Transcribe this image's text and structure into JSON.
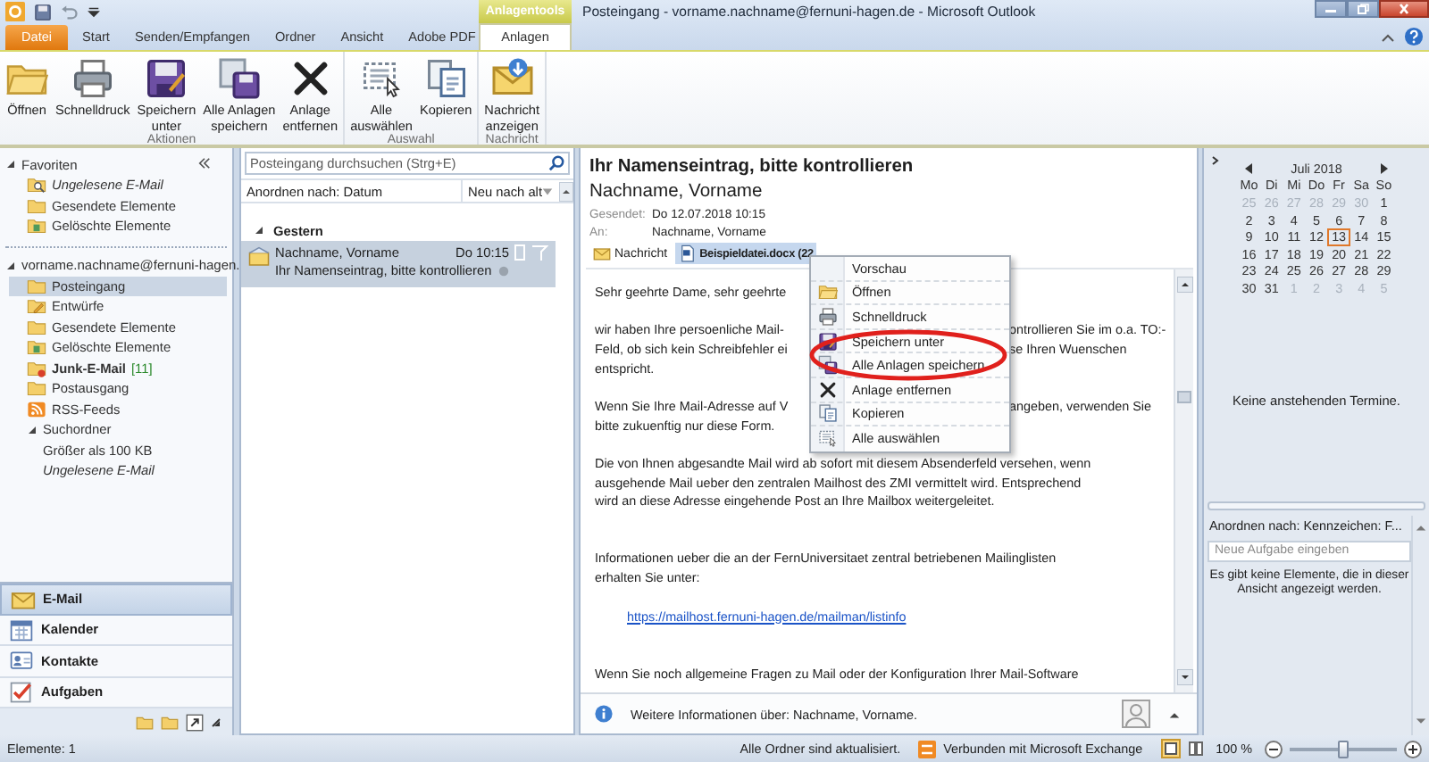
{
  "window": {
    "title": "Posteingang - vorname.nachname@fernuni-hagen.de - Microsoft Outlook",
    "contextual_group": "Anlagentools"
  },
  "ribbon": {
    "tabs": [
      {
        "label": "Datei",
        "kind": "file",
        "selected": false
      },
      {
        "label": "Start",
        "kind": "tab",
        "selected": false
      },
      {
        "label": "Senden/Empfangen",
        "kind": "tab",
        "selected": false
      },
      {
        "label": "Ordner",
        "kind": "tab",
        "selected": false
      },
      {
        "label": "Ansicht",
        "kind": "tab",
        "selected": false
      },
      {
        "label": "Adobe PDF",
        "kind": "tab",
        "selected": false
      },
      {
        "label": "Anlagen",
        "kind": "contextual",
        "selected": true
      }
    ],
    "groups": [
      {
        "label": "Aktionen",
        "buttons": [
          {
            "kind": "openfolder",
            "label": [
              "Öffnen"
            ]
          },
          {
            "kind": "printer",
            "label": [
              "Schnelldruck"
            ]
          },
          {
            "kind": "floppy",
            "label": [
              "Speichern",
              "unter"
            ]
          },
          {
            "kind": "floppies",
            "label": [
              "Alle Anlagen",
              "speichern"
            ]
          },
          {
            "kind": "cross",
            "label": [
              "Anlage",
              "entfernen"
            ]
          }
        ]
      },
      {
        "label": "Auswahl",
        "buttons": [
          {
            "kind": "selection",
            "label": [
              "Alle",
              "auswählen"
            ]
          },
          {
            "kind": "copy",
            "label": [
              "Kopieren"
            ]
          }
        ]
      },
      {
        "label": "Nachricht",
        "buttons": [
          {
            "kind": "envarrow",
            "label": [
              "Nachricht",
              "anzeigen"
            ]
          }
        ]
      }
    ]
  },
  "navigation": {
    "sections": [
      {
        "label": "Favoriten",
        "expanded": true,
        "items": [
          {
            "label": "Ungelesene E-Mail",
            "kind": "search",
            "selected": false,
            "unread": false,
            "empty": true
          },
          {
            "label": "Gesendete Elemente",
            "kind": "folder",
            "selected": false,
            "unread": false,
            "empty": false
          },
          {
            "label": "Gelöschte Elemente",
            "kind": "trash",
            "selected": false,
            "unread": false,
            "empty": false
          }
        ]
      },
      {
        "label": "vorname.nachname@fernuni-hagen.",
        "expanded": true,
        "items": [
          {
            "label": "Posteingang",
            "kind": "folder",
            "selected": true,
            "unread": false,
            "empty": false
          },
          {
            "label": "Entwürfe",
            "kind": "drafts",
            "selected": false,
            "unread": false,
            "empty": false
          },
          {
            "label": "Gesendete Elemente",
            "kind": "folder",
            "selected": false,
            "unread": false,
            "empty": false
          },
          {
            "label": "Gelöschte Elemente",
            "kind": "trash",
            "selected": false,
            "unread": false,
            "empty": false
          },
          {
            "label": "Junk-E-Mail",
            "count": "[11]",
            "kind": "junk",
            "selected": false,
            "unread": true,
            "empty": false
          },
          {
            "label": "Postausgang",
            "kind": "folder",
            "selected": false,
            "unread": false,
            "empty": false
          },
          {
            "label": "RSS-Feeds",
            "kind": "rss",
            "selected": false,
            "unread": false,
            "empty": false
          },
          {
            "label": "Suchordner",
            "selected": false,
            "unread": false,
            "empty": false,
            "expanded": true,
            "children": [
              {
                "label": "Größer als 100 KB",
                "selected": false,
                "unread": false,
                "empty": false
              },
              {
                "label": "Ungelesene E-Mail",
                "selected": false,
                "unread": false,
                "empty": true
              }
            ]
          }
        ]
      }
    ],
    "modules": [
      {
        "label": "E-Mail",
        "kind": "envelope",
        "selected": true
      },
      {
        "label": "Kalender",
        "kind": "calendar",
        "selected": false
      },
      {
        "label": "Kontakte",
        "kind": "contact",
        "selected": false
      },
      {
        "label": "Aufgaben",
        "kind": "tasks",
        "selected": false
      }
    ]
  },
  "message_list": {
    "search": {
      "placeholder": "Posteingang durchsuchen (Strg+E)"
    },
    "sort": "Anordnen nach: Datum",
    "order": "Neu nach alt",
    "groups": [
      {
        "label": "Gestern",
        "expanded": true,
        "messages": [
          {
            "sender": "Nachname, Vorname",
            "time": "Do 10:15",
            "subject": "Ihr Namenseintrag, bitte kontrollieren",
            "selected": true
          }
        ]
      }
    ]
  },
  "reading_pane": {
    "subject": "Ihr Namenseintrag, bitte kontrollieren",
    "sender": "Nachname, Vorname",
    "fields": [
      {
        "label": "Gesendet:",
        "value": "Do 12.07.2018 10:15"
      },
      {
        "label": "An:",
        "value": "Nachname, Vorname"
      }
    ],
    "attachments": [
      {
        "label": "Nachricht",
        "kind": "message",
        "selected": false
      },
      {
        "label": "Beispieldatei.docx (22",
        "kind": "file",
        "selected": true
      }
    ],
    "body": [
      {
        "kind": "text",
        "left": "Sehr geehrte Dame, sehr geehrte"
      },
      {
        "kind": "gap"
      },
      {
        "kind": "text",
        "left": "wir haben Ihre persoenliche Mail-",
        "right": "ontrollieren Sie im o.a. TO:-"
      },
      {
        "kind": "text",
        "left": "Feld, ob sich kein Schreibfehler ei",
        "right": "se Ihren Wuenschen"
      },
      {
        "kind": "text",
        "left": "entspricht."
      },
      {
        "kind": "gap"
      },
      {
        "kind": "text",
        "left": "Wenn Sie Ihre Mail-Adresse auf V",
        "right": "angeben, verwenden Sie"
      },
      {
        "kind": "text",
        "left": "bitte zukuenftig nur diese Form."
      },
      {
        "kind": "gap"
      },
      {
        "kind": "text",
        "left": "Die von Ihnen abgesandte Mail wird ab sofort mit diesem Absenderfeld versehen, wenn"
      },
      {
        "kind": "text",
        "left": "ausgehende Mail ueber den zentralen Mailhost des ZMI vermittelt wird. Entsprechend"
      },
      {
        "kind": "text",
        "left": "wird an diese Adresse eingehende Post an Ihre Mailbox weitergeleitet."
      },
      {
        "kind": "gap"
      },
      {
        "kind": "gap"
      },
      {
        "kind": "text",
        "left": "Informationen ueber die an der FernUniversitaet zentral betriebenen Mailinglisten"
      },
      {
        "kind": "text",
        "left": "erhalten Sie unter:"
      },
      {
        "kind": "gap"
      },
      {
        "kind": "link",
        "text": "https://mailhost.fernuni-hagen.de/mailman/listinfo"
      },
      {
        "kind": "gap"
      },
      {
        "kind": "gap"
      },
      {
        "kind": "text",
        "left": "Wenn Sie noch allgemeine Fragen zu Mail oder der Konfiguration Ihrer Mail-Software"
      }
    ],
    "people_bar": "Weitere Informationen über: Nachname, Vorname."
  },
  "context_menu": [
    {
      "label": "Vorschau"
    },
    {
      "label": "Öffnen",
      "kind": "openfolder"
    },
    {
      "label": "Schnelldruck",
      "kind": "printer"
    },
    {
      "label": "Speichern unter",
      "kind": "floppy"
    },
    {
      "label": "Alle Anlagen speichern",
      "kind": "floppies"
    },
    {
      "label": "Anlage entfernen",
      "kind": "cross"
    },
    {
      "label": "Kopieren",
      "kind": "copy"
    },
    {
      "label": "Alle auswählen",
      "kind": "selection"
    }
  ],
  "todo_bar": {
    "calendar": {
      "month": "Juli 2018",
      "weekdays": [
        "Mo",
        "Di",
        "Mi",
        "Do",
        "Fr",
        "Sa",
        "So"
      ],
      "weeks": [
        [
          {
            "day": "25",
            "other_month": true,
            "today": false
          },
          {
            "day": "26",
            "other_month": true,
            "today": false
          },
          {
            "day": "27",
            "other_month": true,
            "today": false
          },
          {
            "day": "28",
            "other_month": true,
            "today": false
          },
          {
            "day": "29",
            "other_month": true,
            "today": false
          },
          {
            "day": "30",
            "other_month": true,
            "today": false
          },
          {
            "day": "1",
            "other_month": false,
            "today": false
          }
        ],
        [
          {
            "day": "2",
            "other_month": false,
            "today": false
          },
          {
            "day": "3",
            "other_month": false,
            "today": false
          },
          {
            "day": "4",
            "other_month": false,
            "today": false
          },
          {
            "day": "5",
            "other_month": false,
            "today": false
          },
          {
            "day": "6",
            "other_month": false,
            "today": false
          },
          {
            "day": "7",
            "other_month": false,
            "today": false
          },
          {
            "day": "8",
            "other_month": false,
            "today": false
          }
        ],
        [
          {
            "day": "9",
            "other_month": false,
            "today": false
          },
          {
            "day": "10",
            "other_month": false,
            "today": false
          },
          {
            "day": "11",
            "other_month": false,
            "today": false
          },
          {
            "day": "12",
            "other_month": false,
            "today": false
          },
          {
            "day": "13",
            "other_month": false,
            "today": true
          },
          {
            "day": "14",
            "other_month": false,
            "today": false
          },
          {
            "day": "15",
            "other_month": false,
            "today": false
          }
        ],
        [
          {
            "day": "16",
            "other_month": false,
            "today": false
          },
          {
            "day": "17",
            "other_month": false,
            "today": false
          },
          {
            "day": "18",
            "other_month": false,
            "today": false
          },
          {
            "day": "19",
            "other_month": false,
            "today": false
          },
          {
            "day": "20",
            "other_month": false,
            "today": false
          },
          {
            "day": "21",
            "other_month": false,
            "today": false
          },
          {
            "day": "22",
            "other_month": false,
            "today": false
          }
        ],
        [
          {
            "day": "23",
            "other_month": false,
            "today": false
          },
          {
            "day": "24",
            "other_month": false,
            "today": false
          },
          {
            "day": "25",
            "other_month": false,
            "today": false
          },
          {
            "day": "26",
            "other_month": false,
            "today": false
          },
          {
            "day": "27",
            "other_month": false,
            "today": false
          },
          {
            "day": "28",
            "other_month": false,
            "today": false
          },
          {
            "day": "29",
            "other_month": false,
            "today": false
          }
        ],
        [
          {
            "day": "30",
            "other_month": false,
            "today": false
          },
          {
            "day": "31",
            "other_month": false,
            "today": false
          },
          {
            "day": "1",
            "other_month": true,
            "today": false
          },
          {
            "day": "2",
            "other_month": true,
            "today": false
          },
          {
            "day": "3",
            "other_month": true,
            "today": false
          },
          {
            "day": "4",
            "other_month": true,
            "today": false
          },
          {
            "day": "5",
            "other_month": true,
            "today": false
          }
        ]
      ]
    },
    "appointments": "Keine anstehenden Termine.",
    "tasks": {
      "sort": "Anordnen nach: Kennzeichen: F...",
      "placeholder": "Neue Aufgabe eingeben",
      "empty": "Es gibt keine Elemente, die in dieser Ansicht angezeigt werden."
    }
  },
  "status_bar": {
    "items": "Elemente: 1",
    "sync": "Alle Ordner sind aktualisiert.",
    "connection": "Verbunden mit Microsoft Exchange",
    "zoom": "100 %",
    "zoom_slider": {
      "level": 0.5
    }
  }
}
